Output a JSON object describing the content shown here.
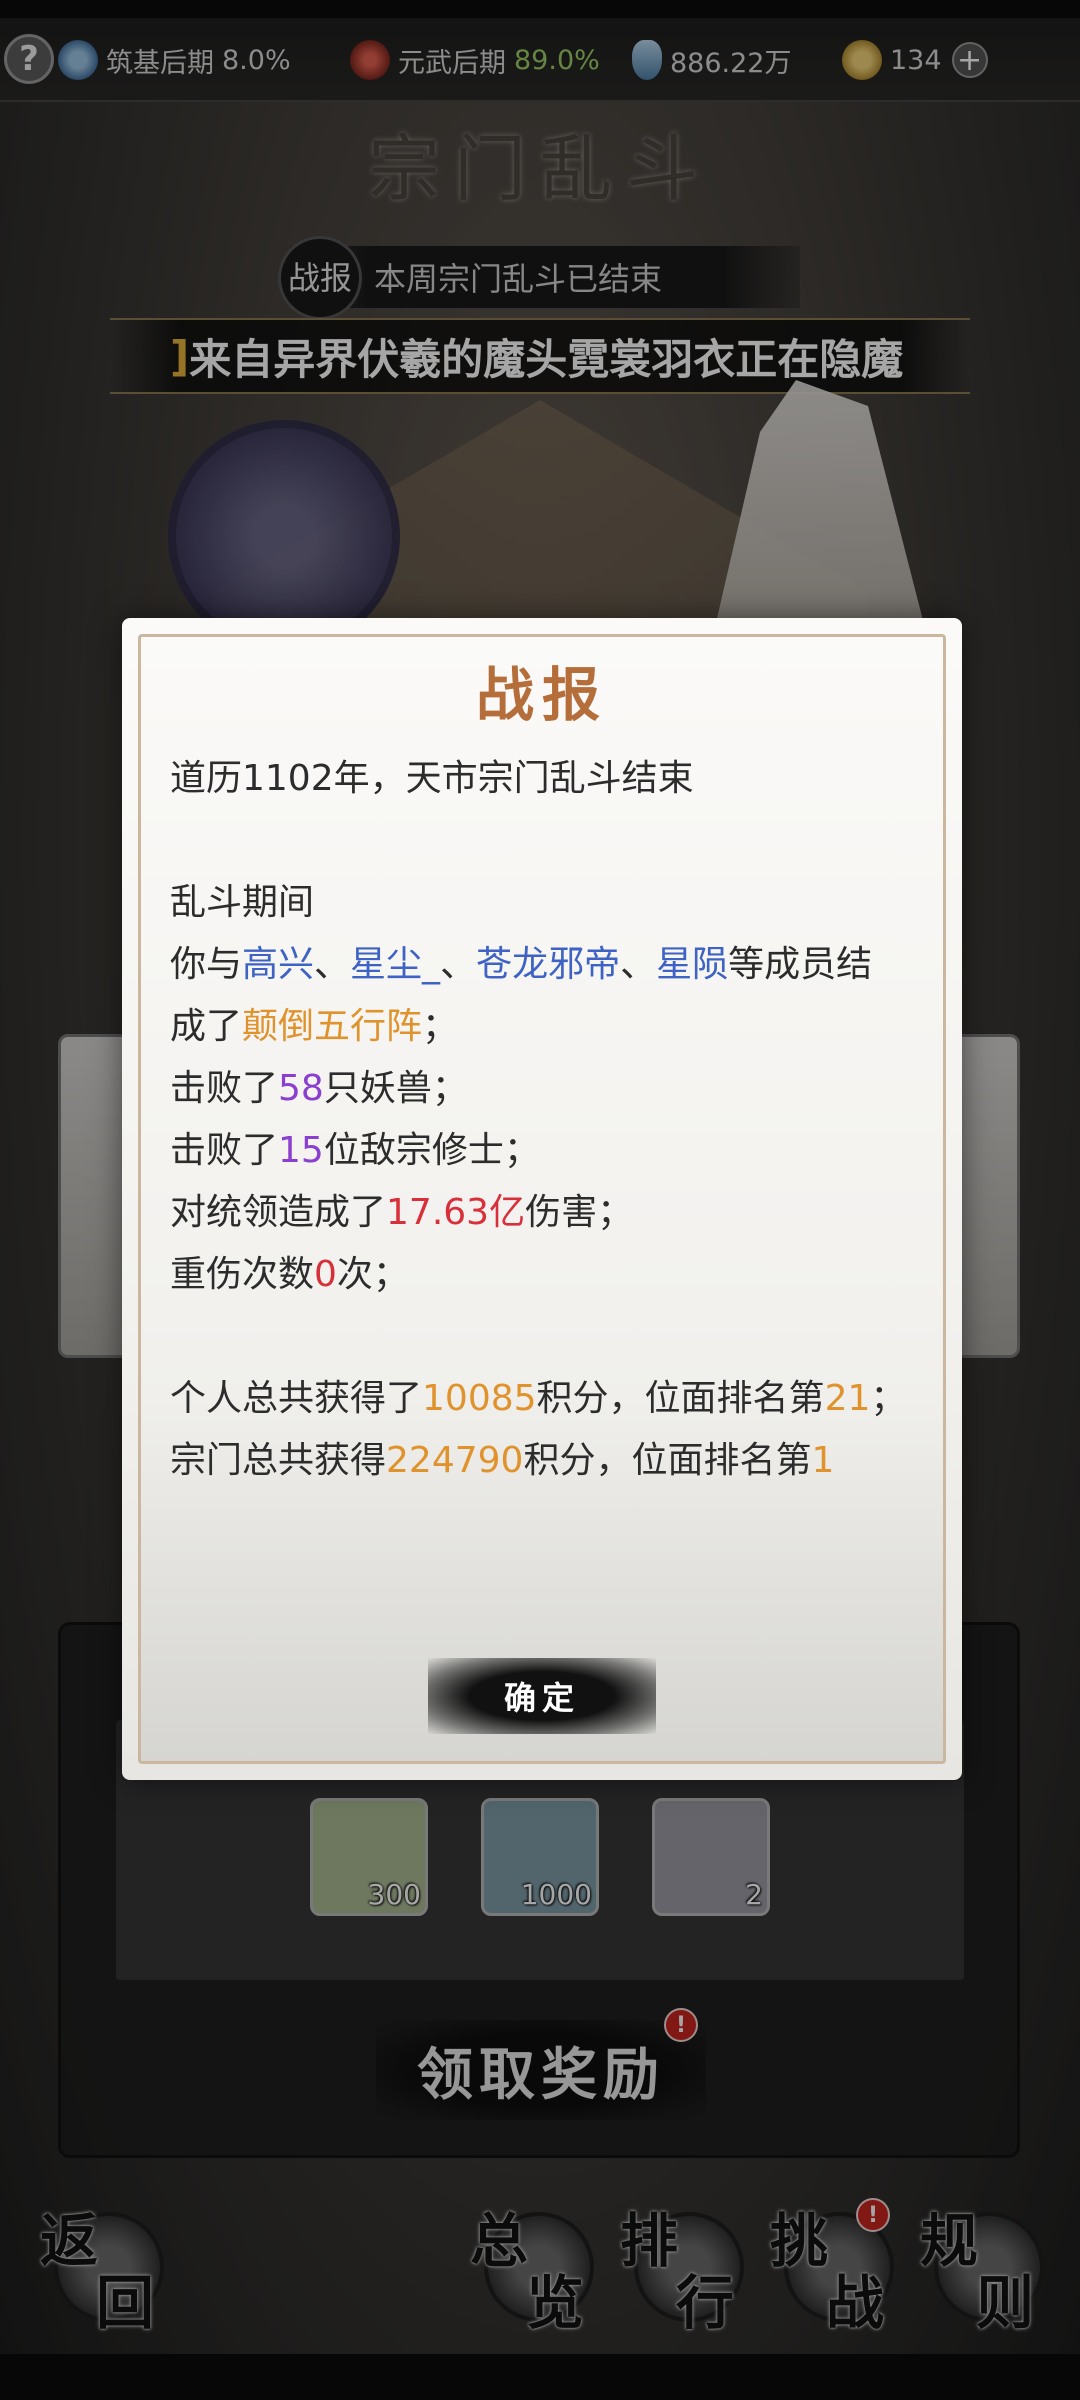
{
  "header": {
    "help_label": "?",
    "cultivation": {
      "stage": "筑基后期",
      "percent": "8.0%"
    },
    "martial": {
      "stage": "元武后期",
      "percent": "89.0%"
    },
    "spirit_stones": "886.22万",
    "currency": "134",
    "plus_label": "+"
  },
  "page": {
    "title": "宗门乱斗",
    "report_seal": "战报",
    "notice": "本周宗门乱斗已结束",
    "marquee_lead": "]",
    "marquee_text": "来自异界伏羲的魔头霓裳羽衣正在隐魔"
  },
  "dialog": {
    "title": "战报",
    "line1": "道历1102年，天市宗门乱斗结束",
    "line2": "乱斗期间",
    "line3": {
      "prefix": "你与",
      "member1": "高兴",
      "sep1": "、",
      "member2": "星尘_",
      "sep2": "、",
      "member3": "苍龙邪帝",
      "sep3": "、",
      "member4": "星陨",
      "suffix": "等成员结"
    },
    "line4": {
      "prefix": "成了",
      "formation": "颠倒五行阵",
      "suffix": "；"
    },
    "line5": {
      "prefix": "击败了",
      "count": "58",
      "suffix": "只妖兽；"
    },
    "line6": {
      "prefix": "击败了",
      "count": "15",
      "suffix": "位敌宗修士；"
    },
    "line7": {
      "prefix": "对统领造成了",
      "damage": "17.63亿",
      "suffix": "伤害；"
    },
    "line8": {
      "prefix": "重伤次数",
      "count": "0",
      "suffix": "次；"
    },
    "line9": {
      "prefix": "个人总共获得了",
      "points": "10085",
      "mid": "积分，位面排名第",
      "rank": "21",
      "suffix": "；"
    },
    "line10": {
      "prefix": "宗门总共获得",
      "points": "224790",
      "mid": "积分，位面排名第",
      "rank": "1"
    },
    "confirm_label": "确定"
  },
  "rewards": [
    {
      "icon": "crystal-ore-icon",
      "qty": "300",
      "bg": "#a9b893"
    },
    {
      "icon": "spirit-swirl-icon",
      "qty": "1000",
      "bg": "#7e9ba6"
    },
    {
      "icon": "pill-bottle-icon",
      "qty": "2",
      "bg": "#9b9aa3"
    }
  ],
  "claim_label": "领取奖励",
  "badge": "!",
  "nav": {
    "back": [
      "返",
      "回"
    ],
    "overview": [
      "总",
      "览"
    ],
    "rank": [
      "排",
      "行"
    ],
    "challenge": [
      "挑",
      "战"
    ],
    "rules": [
      "规",
      "则"
    ]
  },
  "colors": {
    "name_blue": "#3e63c5",
    "highlight_orange": "#e0932c",
    "count_purple": "#8a3fcf",
    "damage_red": "#d8303a",
    "percent_green": "#9acd67"
  }
}
